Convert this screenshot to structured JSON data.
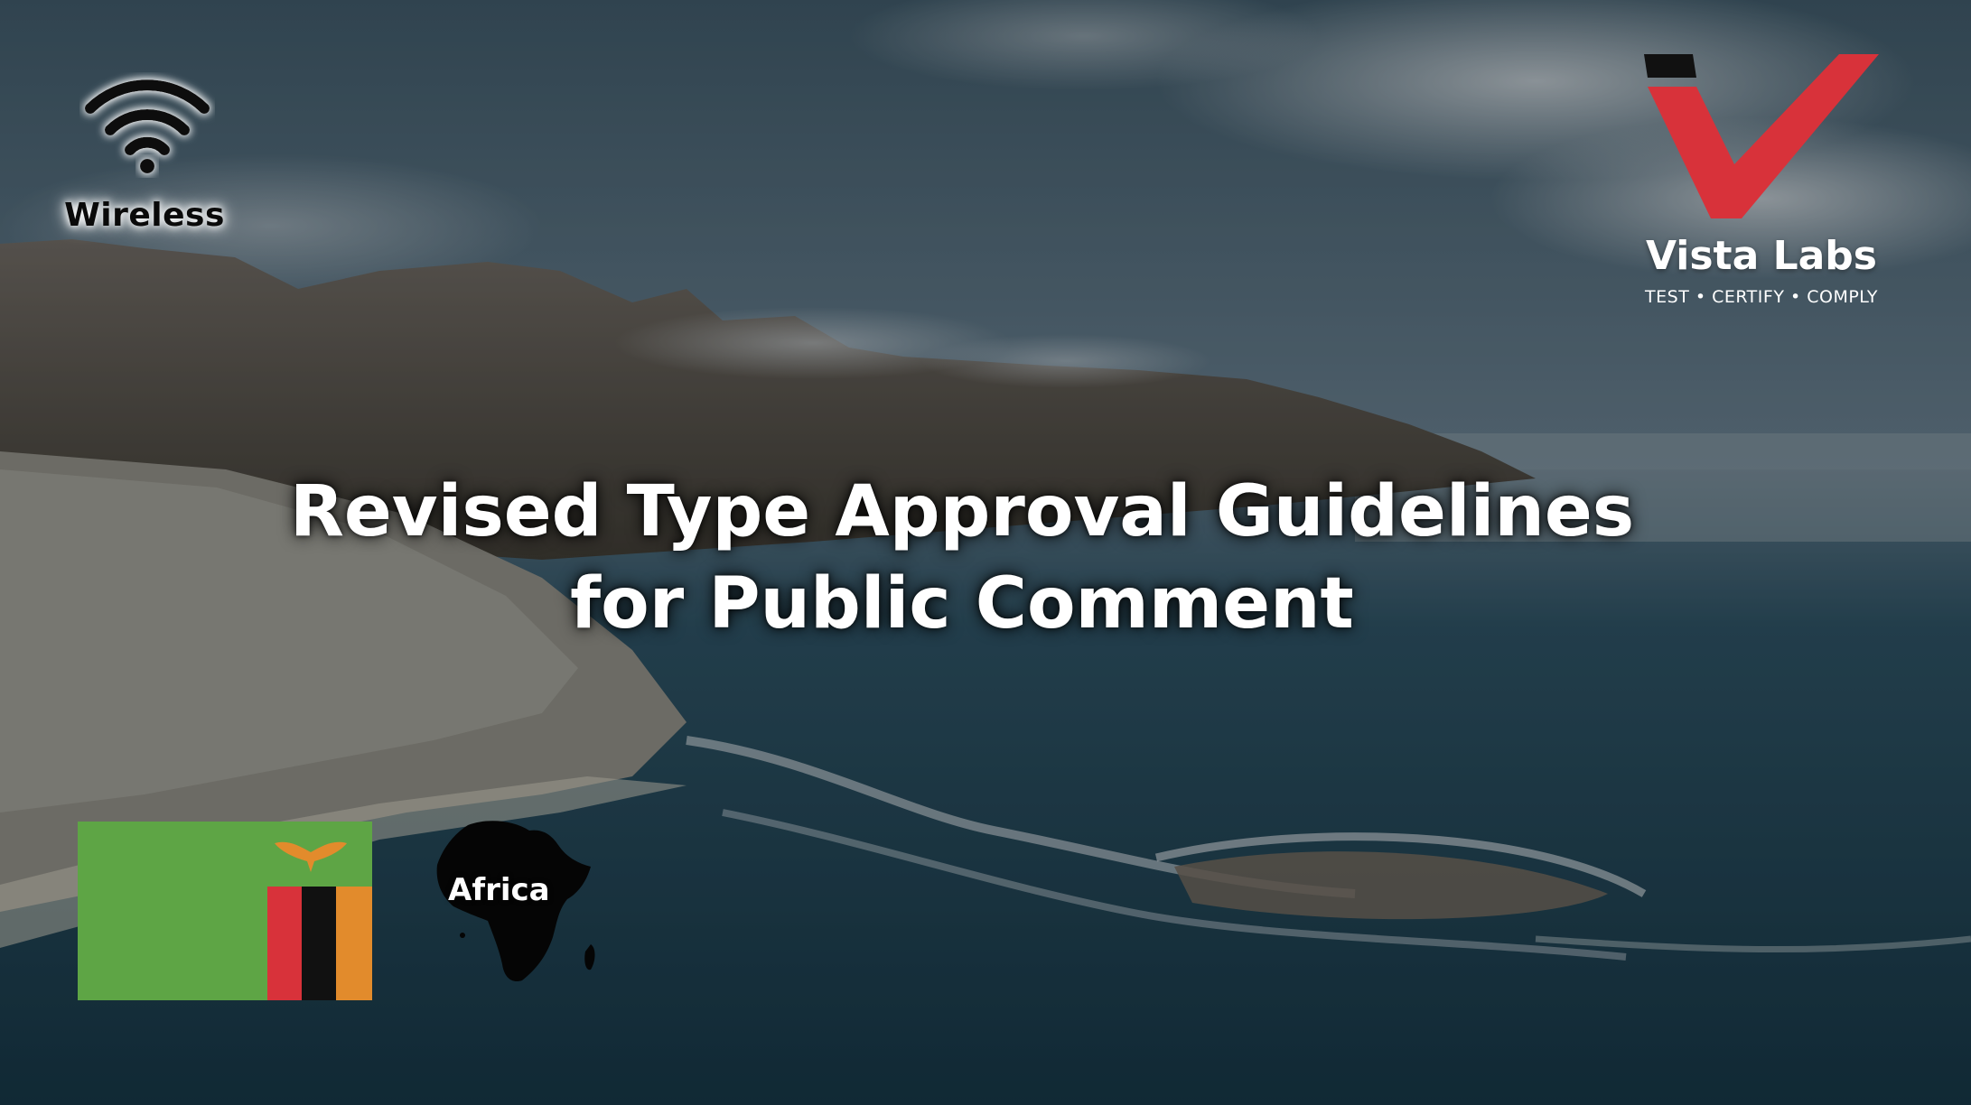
{
  "wireless_label": "Wireless",
  "headline": {
    "line1": "Revised Type Approval Guidelines",
    "line2": "for Public Comment"
  },
  "brand": {
    "name": "Vista Labs",
    "tagline": "TEST • CERTIFY • COMPLY",
    "accent_color": "#d8323a"
  },
  "region_label": "Africa",
  "icons": {
    "wireless": "wifi-icon",
    "flag": "zambia-flag",
    "continent": "africa-map-icon"
  }
}
